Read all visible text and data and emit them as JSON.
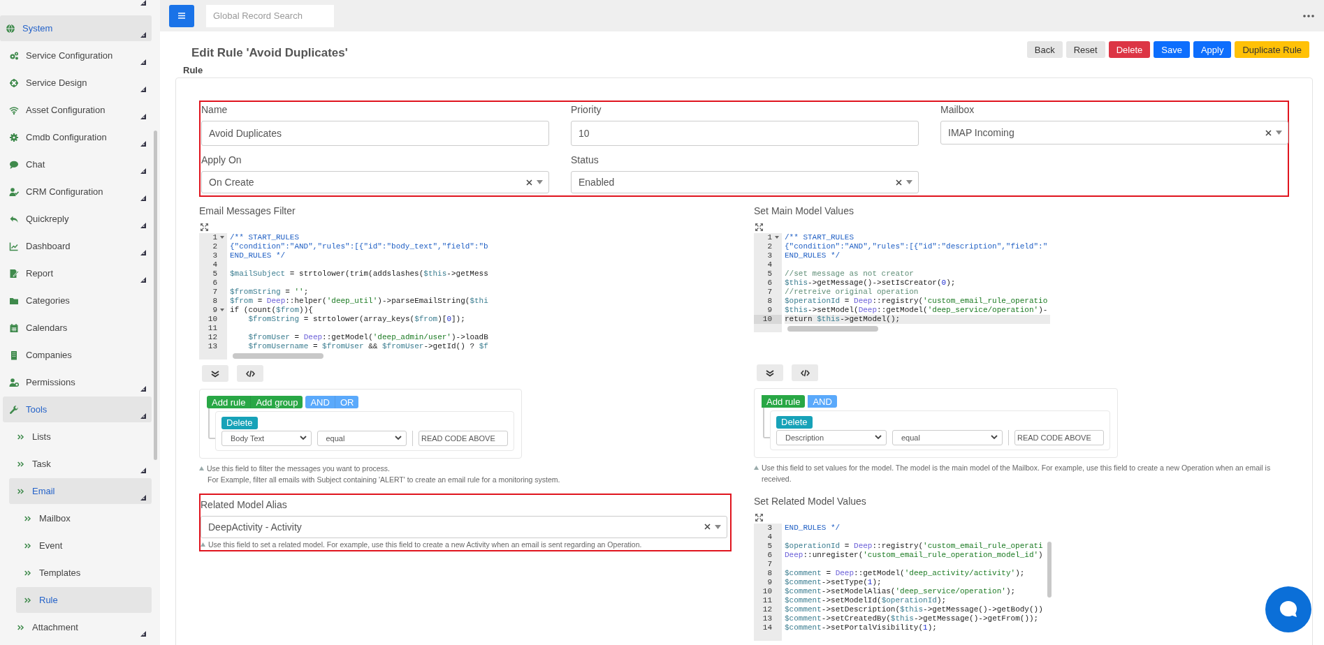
{
  "topbar": {
    "search": {
      "placeholder": "Global Record Search"
    }
  },
  "sidebar": {
    "items": [
      {
        "label": "System",
        "selected": true,
        "expandable": true,
        "children": [
          {
            "label": "Service Configuration",
            "selected": false,
            "expandable": true
          },
          {
            "label": "Service Design",
            "selected": false,
            "expandable": true
          },
          {
            "label": "Asset Configuration",
            "selected": false,
            "expandable": true
          },
          {
            "label": "Cmdb Configuration",
            "selected": false,
            "expandable": true
          },
          {
            "label": "Chat",
            "selected": false,
            "expandable": true
          },
          {
            "label": "CRM Configuration",
            "selected": false,
            "expandable": true
          },
          {
            "label": "Quickreply",
            "selected": false,
            "expandable": true
          },
          {
            "label": "Dashboard",
            "selected": false,
            "expandable": true
          },
          {
            "label": "Report",
            "selected": false,
            "expandable": true
          },
          {
            "label": "Categories",
            "selected": false,
            "expandable": false
          },
          {
            "label": "Calendars",
            "selected": false,
            "expandable": false
          },
          {
            "label": "Companies",
            "selected": false,
            "expandable": false
          },
          {
            "label": "Permissions",
            "selected": false,
            "expandable": true
          },
          {
            "label": "Tools",
            "selected": true,
            "expandable": true,
            "children": [
              {
                "label": "Lists",
                "selected": false,
                "expandable": false
              },
              {
                "label": "Task",
                "selected": false,
                "expandable": true
              },
              {
                "label": "Email",
                "selected": true,
                "expandable": true,
                "children": [
                  {
                    "label": "Mailbox",
                    "selected": false,
                    "expandable": false
                  },
                  {
                    "label": "Event",
                    "selected": false,
                    "expandable": false
                  },
                  {
                    "label": "Templates",
                    "selected": false,
                    "expandable": false
                  },
                  {
                    "label": "Rule",
                    "selected": true,
                    "expandable": false
                  }
                ]
              },
              {
                "label": "Attachment",
                "selected": false,
                "expandable": true
              }
            ]
          }
        ]
      }
    ]
  },
  "header": {
    "title": "Edit Rule 'Avoid Duplicates'",
    "actions": [
      {
        "label": "Back",
        "kind": "default"
      },
      {
        "label": "Reset",
        "kind": "default"
      },
      {
        "label": "Delete",
        "kind": "danger"
      },
      {
        "label": "Save",
        "kind": "primary"
      },
      {
        "label": "Apply",
        "kind": "primary"
      },
      {
        "label": "Duplicate Rule",
        "kind": "warning"
      }
    ]
  },
  "section_title": "Rule",
  "form": {
    "fields": [
      {
        "label": "Name",
        "kind": "text",
        "value": "Avoid Duplicates"
      },
      {
        "label": "Priority",
        "kind": "text",
        "value": "10"
      },
      {
        "label": "Mailbox",
        "kind": "select",
        "value": "IMAP Incoming"
      },
      {
        "label": "Apply On",
        "kind": "select",
        "value": "On Create"
      },
      {
        "label": "Status",
        "kind": "select",
        "value": "Enabled"
      }
    ]
  },
  "filter": {
    "title": "Email Messages Filter",
    "editor": {
      "lines": [
        {
          "n": "1",
          "text": "/** START_RULES",
          "fold": true,
          "active": false
        },
        {
          "n": "2",
          "text": "{\"condition\":\"AND\",\"rules\":[{\"id\":\"body_text\",\"field\":\"b",
          "fold": false,
          "active": false
        },
        {
          "n": "3",
          "text": "END_RULES */",
          "fold": false,
          "active": false
        },
        {
          "n": "4",
          "fold": false,
          "active": false
        },
        {
          "n": "5",
          "text": "$mailSubject = strtolower(trim(addslashes($this->getMess",
          "fold": false,
          "active": false
        },
        {
          "n": "6",
          "fold": false,
          "active": false
        },
        {
          "n": "7",
          "text": "$fromString = '';",
          "fold": false,
          "active": false
        },
        {
          "n": "8",
          "text": "$from = Deep::helper('deep_util')->parseEmailString($thi",
          "fold": false,
          "active": false
        },
        {
          "n": "9",
          "text": "if (count($from)){",
          "fold": true,
          "active": false
        },
        {
          "n": "10",
          "text": "    $fromString = strtolower(array_keys($from)[0]);",
          "fold": false,
          "active": false
        },
        {
          "n": "11",
          "fold": false,
          "active": false
        },
        {
          "n": "12",
          "text": "    $fromUser = Deep::getModel('deep_admin/user')->loadB",
          "fold": false,
          "active": false
        },
        {
          "n": "13",
          "text": "    $fromUsername = $fromUser && $fromUser->getId() ? $f",
          "fold": false,
          "active": false
        }
      ]
    },
    "builder": {
      "buttons": [
        {
          "label": "Add rule",
          "kind": "add"
        },
        {
          "label": "Add group",
          "kind": "add"
        },
        {
          "label": "AND",
          "kind": "conjunction"
        },
        {
          "label": "OR",
          "kind": "conjunction"
        }
      ],
      "rule": {
        "delete": "Delete",
        "field": "Body Text",
        "operator": "equal",
        "value": "READ CODE ABOVE"
      }
    },
    "help": [
      "Use this field to filter the messages you want to process.",
      "For Example, filter all emails with Subject containing 'ALERT' to create an email rule for a monitoring system."
    ]
  },
  "related_alias": {
    "label": "Related Model Alias",
    "value": "DeepActivity - Activity",
    "help": "Use this field to set a related model. For example, use this field to create a new Activity when an email is sent regarding an Operation."
  },
  "main_values": {
    "title": "Set Main Model Values",
    "editor": {
      "lines": [
        {
          "n": "1",
          "text": "/** START_RULES",
          "fold": true,
          "active": false
        },
        {
          "n": "2",
          "text": "{\"condition\":\"AND\",\"rules\":[{\"id\":\"description\",\"field\":\"",
          "fold": false,
          "active": false
        },
        {
          "n": "3",
          "text": "END_RULES */",
          "fold": false,
          "active": false
        },
        {
          "n": "4",
          "fold": false,
          "active": false
        },
        {
          "n": "5",
          "text": "//set message as not creator",
          "fold": false,
          "active": false
        },
        {
          "n": "6",
          "text": "$this->getMessage()->setIsCreator(0);",
          "fold": false,
          "active": false
        },
        {
          "n": "7",
          "text": "//retreive original operation",
          "fold": false,
          "active": false
        },
        {
          "n": "8",
          "text": "$operationId = Deep::registry('custom_email_rule_operatio",
          "fold": false,
          "active": false
        },
        {
          "n": "9",
          "text": "$this->setModel(Deep::getModel('deep_service/operation')-",
          "fold": false,
          "active": false
        },
        {
          "n": "10",
          "text": "return $this->getModel();",
          "fold": false,
          "active": true
        }
      ]
    },
    "builder": {
      "buttons": [
        {
          "label": "Add rule",
          "kind": "add"
        },
        {
          "label": "AND",
          "kind": "conjunction"
        }
      ],
      "rule": {
        "delete": "Delete",
        "field": "Description",
        "operator": "equal",
        "value": "READ CODE ABOVE"
      }
    },
    "help": [
      "Use this field to set values for the model. The model is the main model of the Mailbox. For example, use this field to create a new Operation when an email is received."
    ]
  },
  "related_values": {
    "title": "Set Related Model Values",
    "editor": {
      "lines": [
        {
          "n": "3",
          "text": "END_RULES */",
          "fold": false,
          "active": false
        },
        {
          "n": "4",
          "fold": false,
          "active": false
        },
        {
          "n": "5",
          "text": "$operationId = Deep::registry('custom_email_rule_operati",
          "fold": false,
          "active": false
        },
        {
          "n": "6",
          "text": "Deep::unregister('custom_email_rule_operation_model_id')",
          "fold": false,
          "active": false
        },
        {
          "n": "7",
          "fold": false,
          "active": false
        },
        {
          "n": "8",
          "text": "$comment = Deep::getModel('deep_activity/activity');",
          "fold": false,
          "active": false
        },
        {
          "n": "9",
          "text": "$comment->setType(1);",
          "fold": false,
          "active": false
        },
        {
          "n": "10",
          "text": "$comment->setModelAlias('deep_service/operation');",
          "fold": false,
          "active": false
        },
        {
          "n": "11",
          "text": "$comment->setModelId($operationId);",
          "fold": false,
          "active": false
        },
        {
          "n": "12",
          "text": "$comment->setDescription($this->getMessage()->getBody())",
          "fold": false,
          "active": false
        },
        {
          "n": "13",
          "text": "$comment->setCreatedBy($this->getMessage()->getFrom());",
          "fold": false,
          "active": false
        },
        {
          "n": "14",
          "text": "$comment->setPortalVisibility(1);",
          "fold": false,
          "active": false
        }
      ]
    }
  }
}
